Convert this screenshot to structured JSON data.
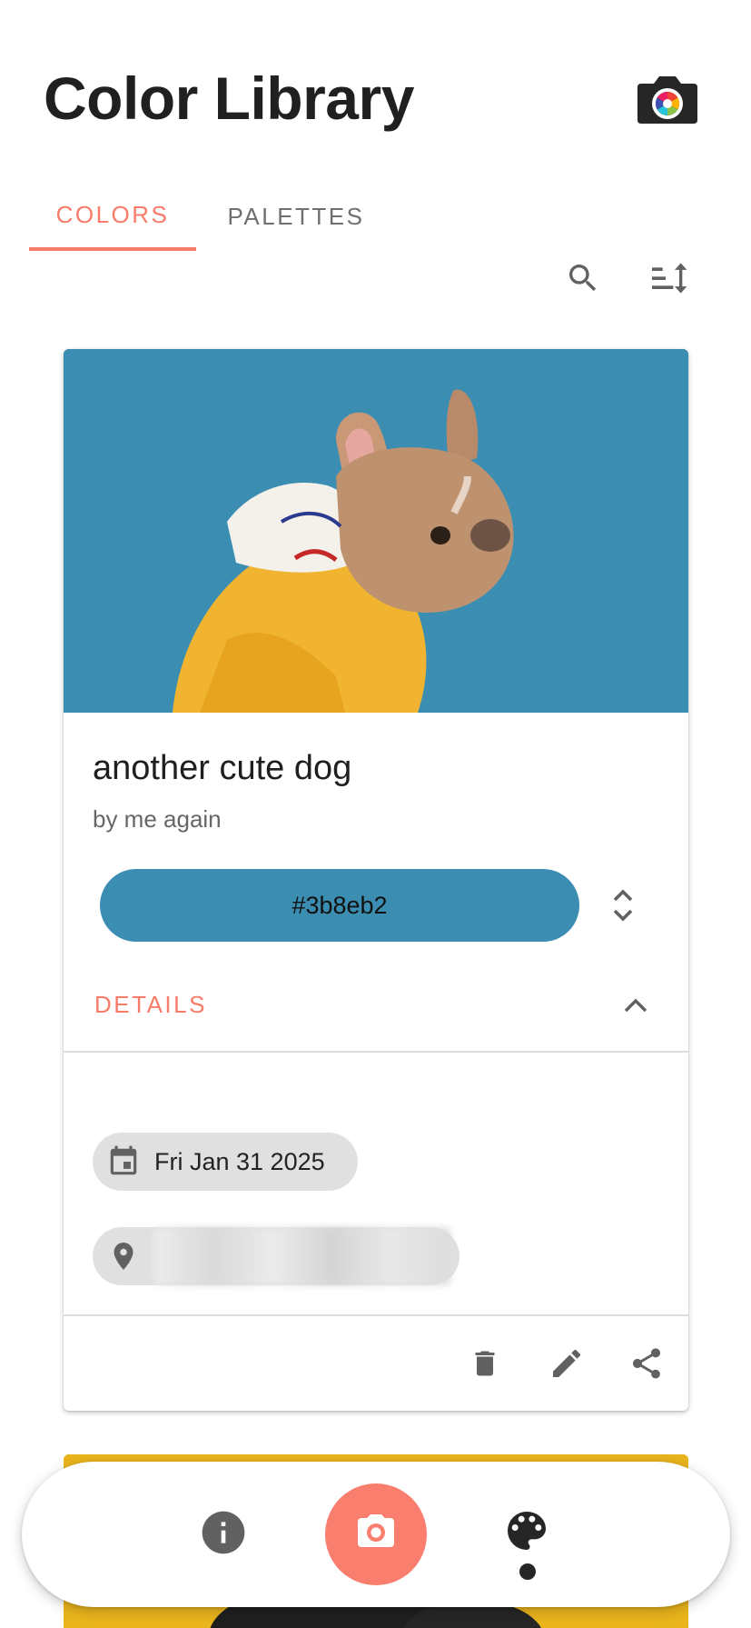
{
  "app": {
    "title": "Color Library"
  },
  "tabs": [
    {
      "label": "COLORS",
      "active": true
    },
    {
      "label": "PALETTES",
      "active": false
    }
  ],
  "toolbar": {
    "search_icon": "search-icon",
    "sort_icon": "sort-icon"
  },
  "card": {
    "title": "another cute dog",
    "subtitle": "by me again",
    "color": {
      "hex": "#3b8eb2",
      "label": "#3b8eb2"
    },
    "details_label": "DETAILS",
    "date_chip": "Fri Jan 31 2025",
    "actions": [
      "delete-icon",
      "edit-icon",
      "share-icon"
    ]
  },
  "bottom_nav": {
    "items": [
      "info-icon",
      "camera-icon",
      "palette-icon"
    ],
    "active_index": 2
  },
  "colors": {
    "accent": "#f77c6a",
    "fab": "#fa7e6e",
    "next_card_bg": "#e9b41c",
    "icon_gray": "#616161"
  }
}
